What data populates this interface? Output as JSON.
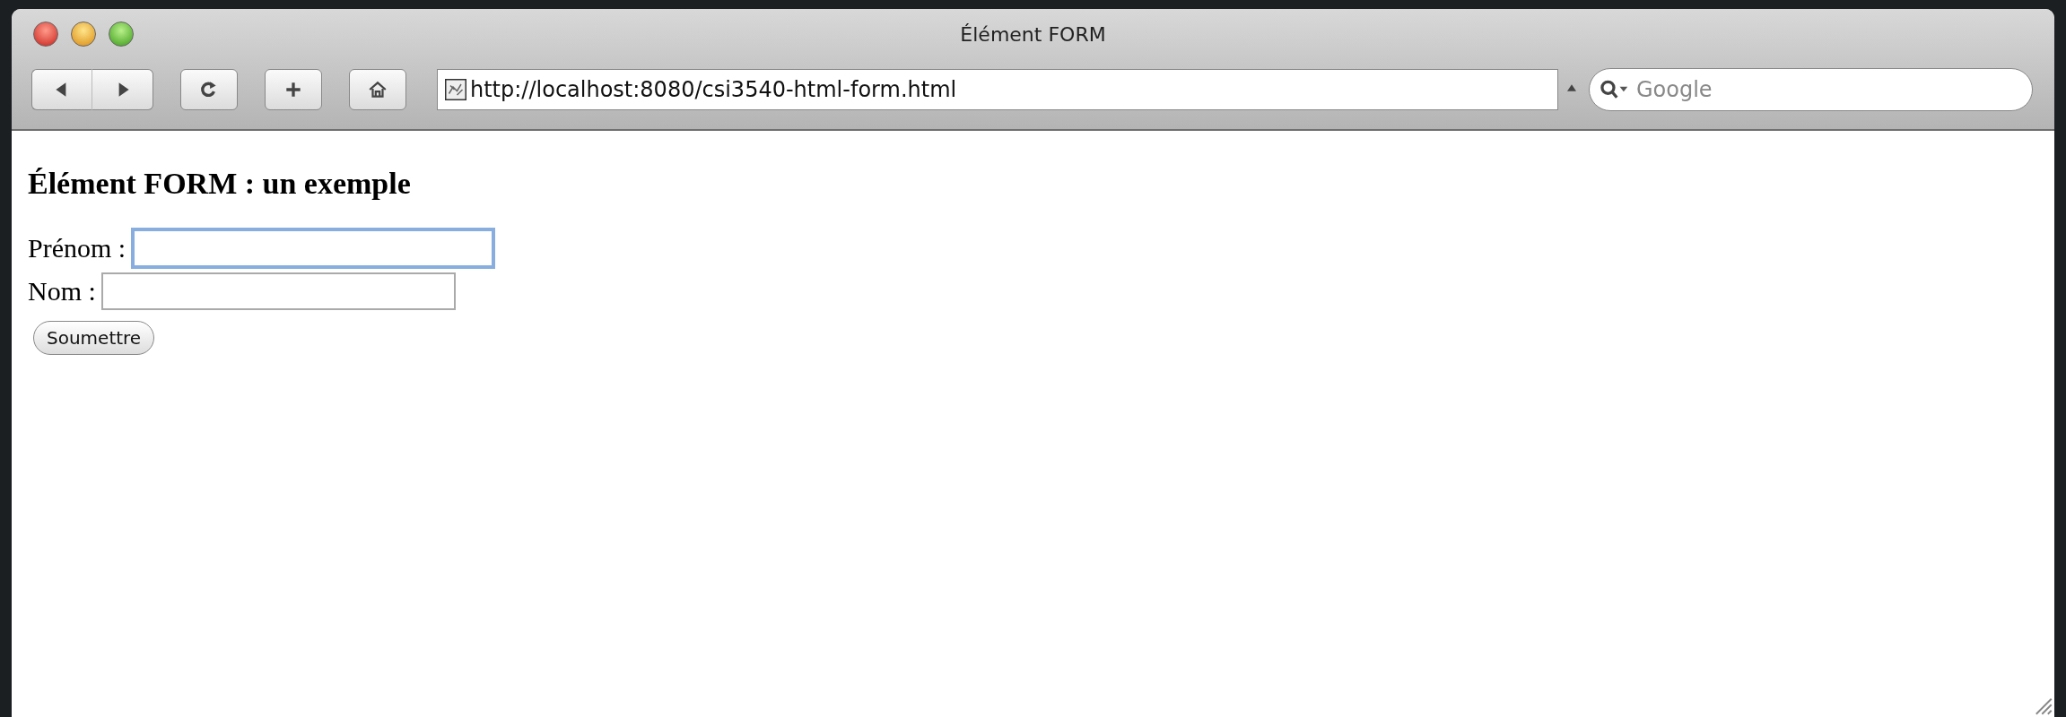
{
  "window": {
    "title": "Élément FORM"
  },
  "toolbar": {
    "buttons": [
      {
        "kind": "back"
      },
      {
        "kind": "forward"
      },
      {
        "kind": "reload"
      },
      {
        "kind": "add"
      },
      {
        "kind": "home"
      }
    ],
    "address": {
      "value": "http://localhost:8080/csi3540-html-form.html"
    },
    "search": {
      "placeholder": "Google"
    }
  },
  "page": {
    "heading": "Élément FORM : un exemple",
    "fields": [
      {
        "label": "Prénom :",
        "focused": true
      },
      {
        "label": "Nom :",
        "focused": false
      }
    ],
    "submit": {
      "label": "Soumettre"
    }
  }
}
